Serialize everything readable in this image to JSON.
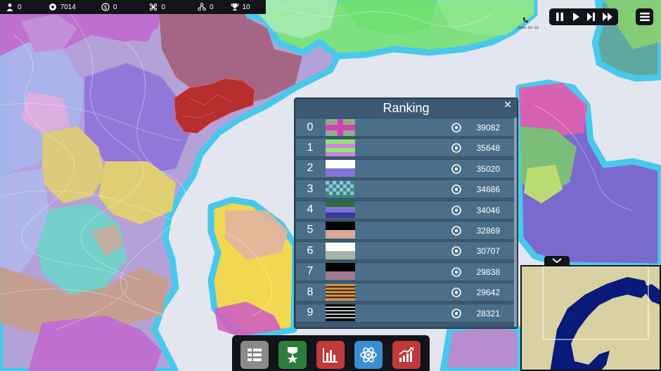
{
  "top_bar": {
    "stats": [
      {
        "icon": "population-icon",
        "value": "0"
      },
      {
        "icon": "research-icon",
        "value": "7014"
      },
      {
        "icon": "money-icon",
        "value": "0"
      },
      {
        "icon": "virus-icon",
        "value": "0"
      },
      {
        "icon": "network-icon",
        "value": "0"
      },
      {
        "icon": "trophy-icon",
        "value": "10"
      }
    ]
  },
  "clock": {
    "date": "0000-02-15"
  },
  "speed_controls": [
    "pause-icon",
    "play-icon",
    "fast-icon",
    "fastest-icon"
  ],
  "ranking": {
    "title": "Ranking",
    "close": "✕",
    "rows": [
      {
        "rank": "0",
        "score": "39082"
      },
      {
        "rank": "1",
        "score": "35648"
      },
      {
        "rank": "2",
        "score": "35020"
      },
      {
        "rank": "3",
        "score": "34686"
      },
      {
        "rank": "4",
        "score": "34046"
      },
      {
        "rank": "5",
        "score": "32869"
      },
      {
        "rank": "6",
        "score": "30707"
      },
      {
        "rank": "7",
        "score": "29838"
      },
      {
        "rank": "8",
        "score": "29642"
      },
      {
        "rank": "9",
        "score": "28321"
      }
    ]
  },
  "dock": {
    "buttons": [
      {
        "icon": "list-icon",
        "color": "#8a8a8a"
      },
      {
        "icon": "medal-icon",
        "color": "#2f7d3b"
      },
      {
        "icon": "bar-chart-icon",
        "color": "#c0393b"
      },
      {
        "icon": "atom-icon",
        "color": "#3a8ecf"
      },
      {
        "icon": "growth-chart-icon",
        "color": "#c0393b"
      }
    ]
  },
  "colors": {
    "ocean": "#e3e6ee",
    "coast": "#48c9ec",
    "panel": "#3d5a72",
    "row": "#4b6f8a",
    "selected_region": "#b62e2e"
  }
}
